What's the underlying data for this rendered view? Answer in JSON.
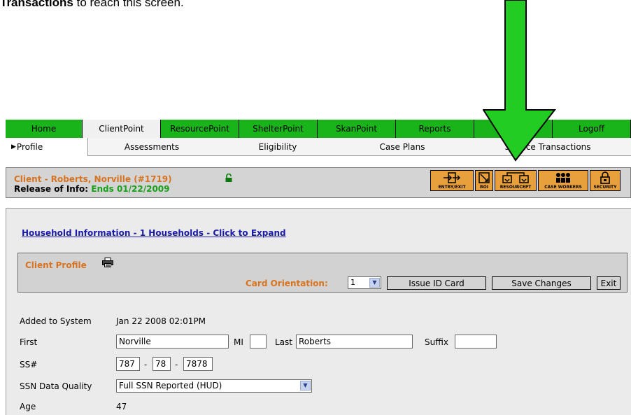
{
  "intro": {
    "bold": "Transactions",
    "rest": " to reach this screen."
  },
  "top_nav": {
    "tabs": [
      {
        "label": "Home"
      },
      {
        "label": "ClientPoint"
      },
      {
        "label": "ResourcePoint"
      },
      {
        "label": "ShelterPoint"
      },
      {
        "label": "SkanPoint"
      },
      {
        "label": "Reports"
      },
      {
        "label": ""
      },
      {
        "label": "Logoff"
      }
    ]
  },
  "sub_nav": {
    "tabs": [
      {
        "label": "Profile"
      },
      {
        "label": "Assessments"
      },
      {
        "label": "Eligibility"
      },
      {
        "label": "Case Plans"
      },
      {
        "label": "Service Transactions"
      }
    ]
  },
  "client": {
    "name": "Client - Roberts, Norville (#1719)",
    "roi_label": "Release of Info:",
    "roi_value": "Ends 01/22/2009"
  },
  "toolbar": {
    "buttons": [
      {
        "label": "ENTRY/EXIT"
      },
      {
        "label": "ROI"
      },
      {
        "label": "RESOURCEPT"
      },
      {
        "label": "CASE WORKERS"
      },
      {
        "label": "SECURITY"
      }
    ]
  },
  "household_link": "Household Information - 1 Households - Click to Expand",
  "profile": {
    "title": "Client Profile",
    "card_orientation_label": "Card Orientation:",
    "card_orientation_value": "1",
    "issue_button": "Issue ID Card",
    "save_button": "Save Changes",
    "exit_button": "Exit"
  },
  "fields": {
    "added_label": "Added to System",
    "added_value": "Jan 22 2008 02:01PM",
    "first_label": "First",
    "first_value": "Norville",
    "mi_label": "MI",
    "mi_value": "",
    "last_label": "Last",
    "last_value": "Roberts",
    "suffix_label": "Suffix",
    "suffix_value": "",
    "ssn_label": "SS#",
    "ssn_part1": "787",
    "ssn_part2": "78",
    "ssn_part3": "7878",
    "ssn_sep": "-",
    "ssn_quality_label": "SSN Data Quality",
    "ssn_quality_value": "Full SSN Reported (HUD)",
    "age_label": "Age",
    "age_value": "47"
  },
  "colors": {
    "nav_green": "#19b419",
    "client_orange": "#d8731f",
    "link_blue": "#1a1aa8",
    "arrow_green": "#22cc22",
    "roi_green": "#16a116"
  }
}
